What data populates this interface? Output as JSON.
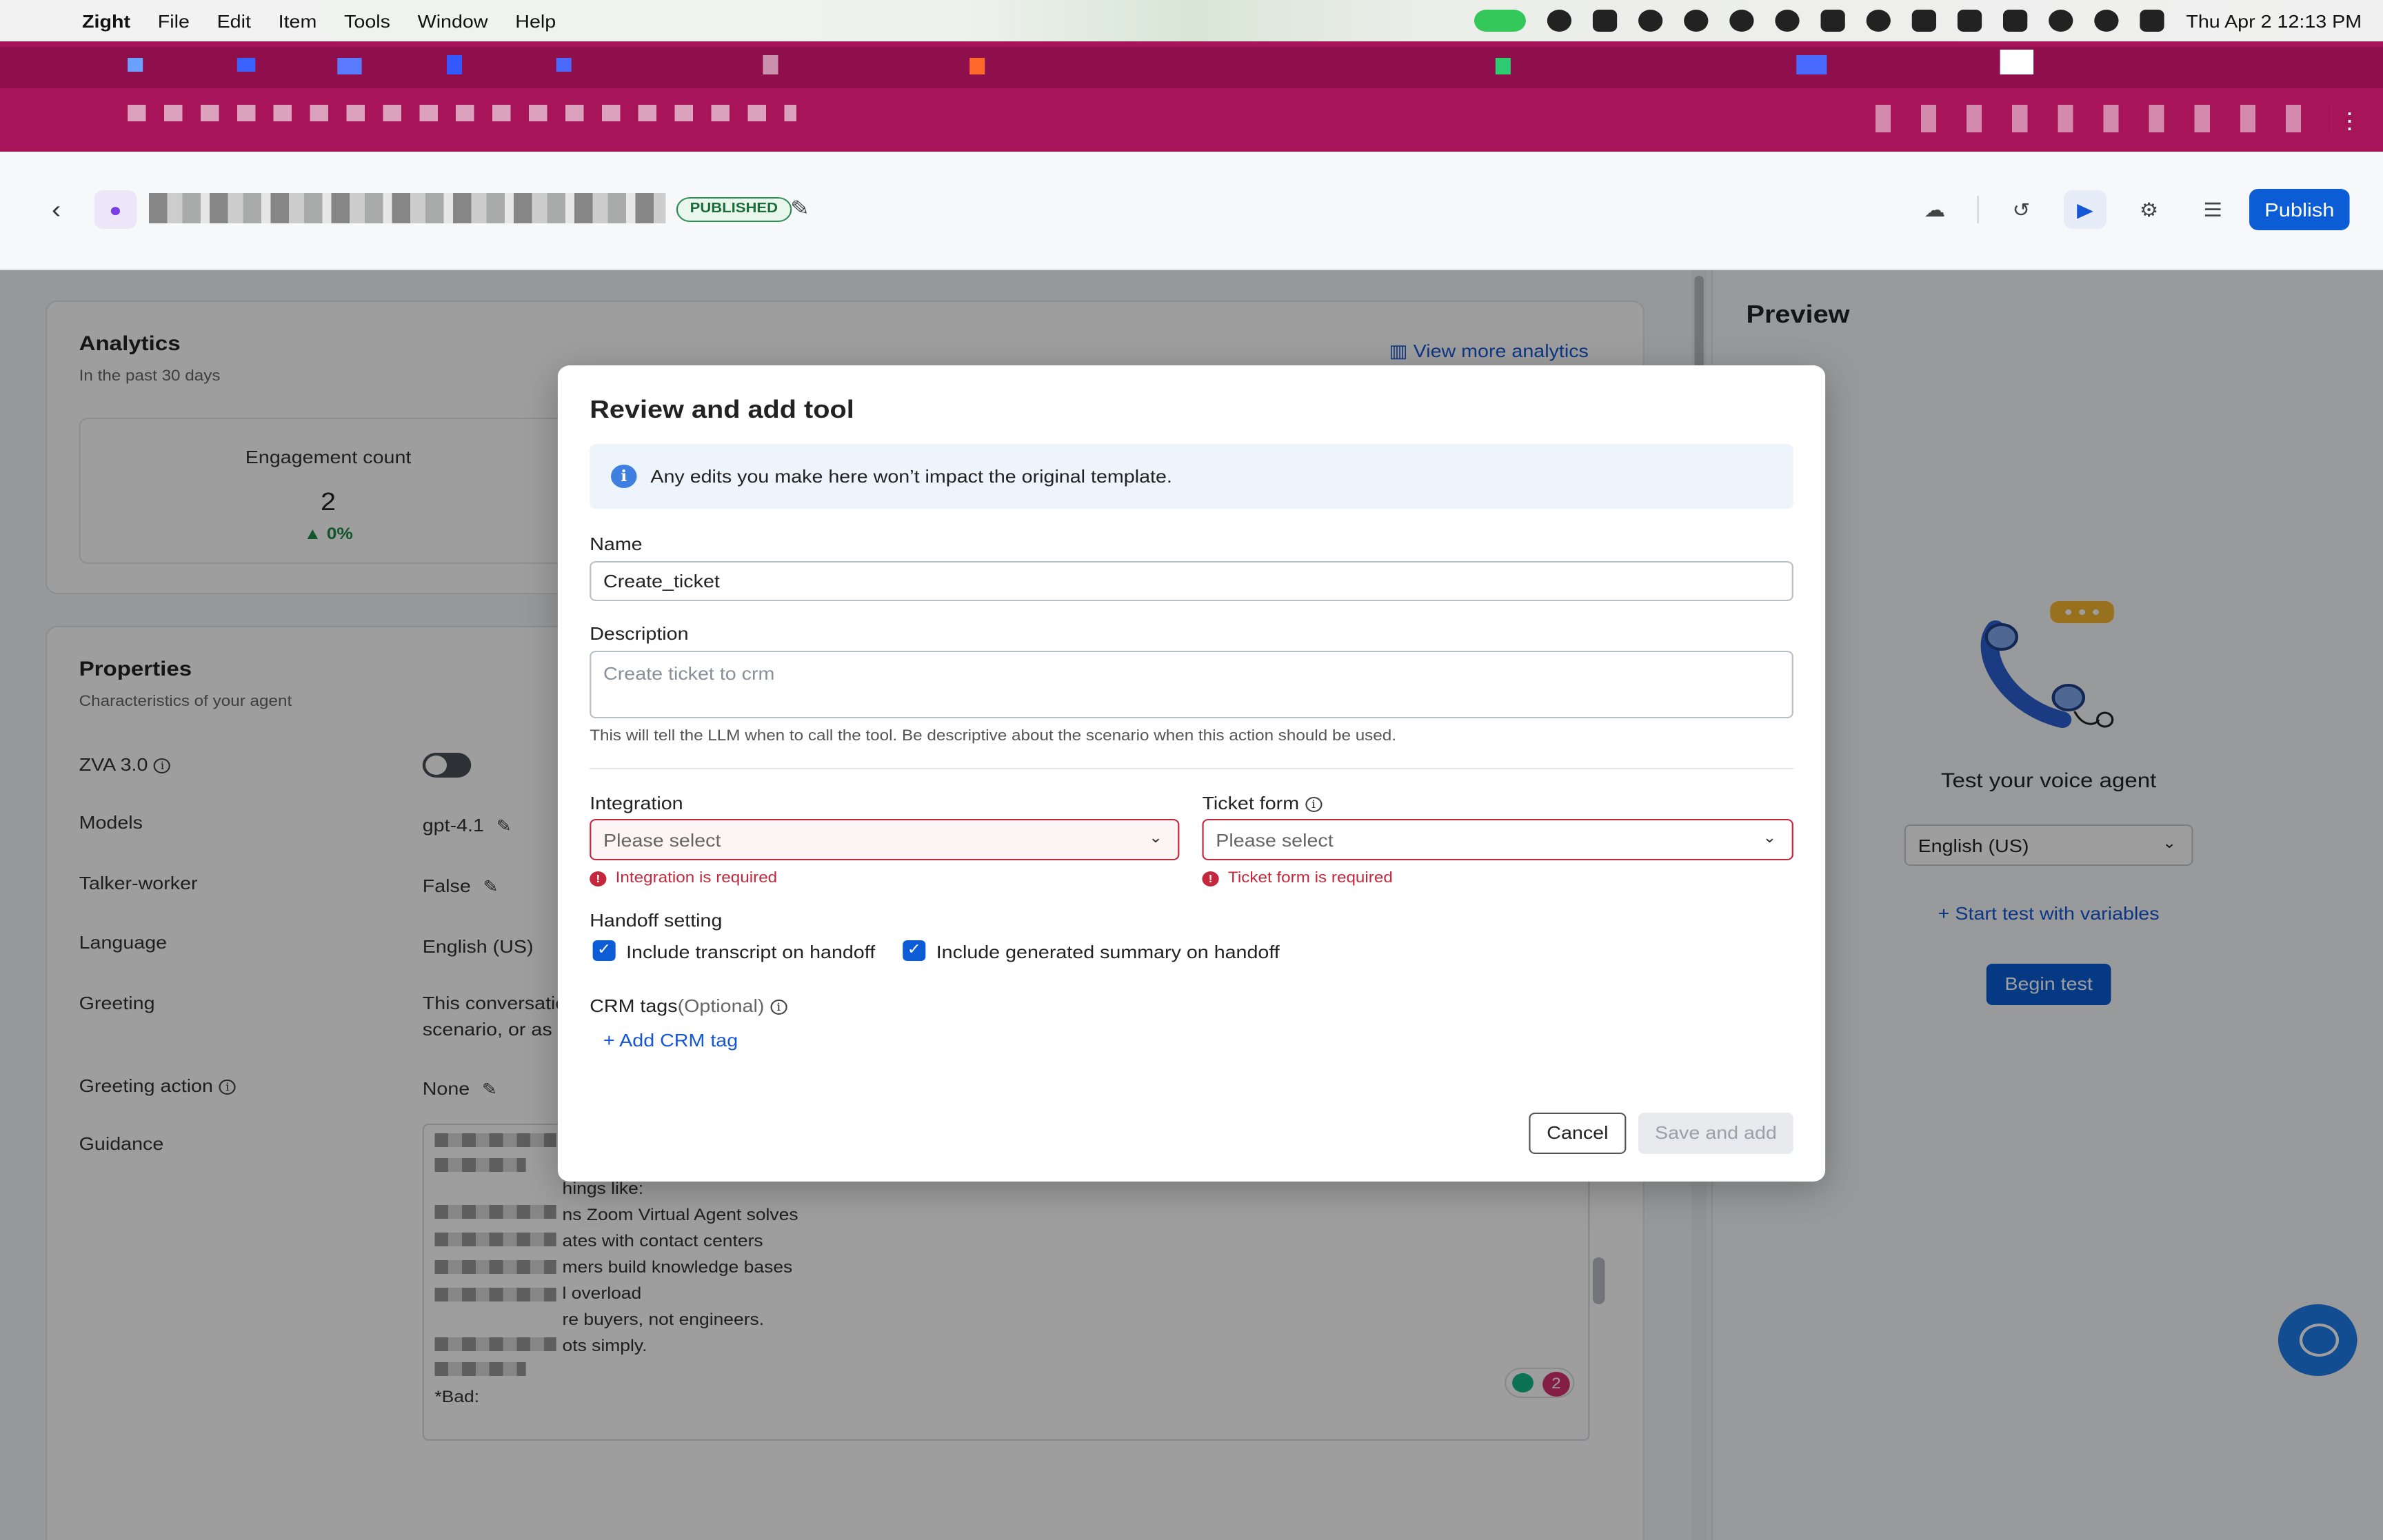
{
  "menubar": {
    "app_name": "Zight",
    "menus": [
      "File",
      "Edit",
      "Item",
      "Tools",
      "Window",
      "Help"
    ],
    "clock": "Thu Apr 2  12:13 PM"
  },
  "header": {
    "status_badge": "PUBLISHED",
    "publish_label": "Publish"
  },
  "analytics": {
    "title": "Analytics",
    "subtitle": "In the past 30 days",
    "view_more": "View more analytics",
    "metric": {
      "label": "Engagement count",
      "value": "2",
      "delta": "▲ 0%"
    }
  },
  "properties": {
    "title": "Properties",
    "subtitle": "Characteristics of your agent",
    "rows": [
      {
        "label": "ZVA 3.0",
        "value": ""
      },
      {
        "label": "Models",
        "value": "gpt-4.1"
      },
      {
        "label": "Talker-worker",
        "value": "False"
      },
      {
        "label": "Language",
        "value": "English (US)"
      },
      {
        "label": "Greeting",
        "value": "This conversatio",
        "value2": "scenario, or as a"
      },
      {
        "label": "Greeting action",
        "value": "None"
      },
      {
        "label": "Guidance",
        "value": ""
      }
    ],
    "guidance_lines": [
      "hings like:",
      "ns Zoom Virtual Agent solves",
      "ates with contact centers",
      "mers build knowledge bases",
      "l overload",
      "re buyers, not engineers.",
      "ots simply.",
      "*Bad:"
    ],
    "grammar_count": "2"
  },
  "preview": {
    "title": "Preview",
    "voice_title": "Test your voice agent",
    "language": "English (US)",
    "start_vars": "Start test with variables",
    "begin_test": "Begin test"
  },
  "modal": {
    "title": "Review and add tool",
    "notice": "Any edits you make here won’t impact the original template.",
    "name_label": "Name",
    "name_value": "Create_ticket",
    "description_label": "Description",
    "description_placeholder": "Create ticket to crm",
    "description_hint": "This will tell the LLM when to call the tool. Be descriptive about the scenario when this action should be used.",
    "integration_label": "Integration",
    "integration_placeholder": "Please select",
    "integration_error": "Integration is required",
    "ticket_form_label": "Ticket form",
    "ticket_form_placeholder": "Please select",
    "ticket_form_error": "Ticket form is required",
    "handoff_label": "Handoff setting",
    "handoff_transcript": "Include transcript on handoff",
    "handoff_summary": "Include generated summary on handoff",
    "crm_tags_label": "CRM tags",
    "crm_tags_optional": "(Optional)",
    "add_crm_tag": "Add CRM tag",
    "cancel": "Cancel",
    "save_and_add": "Save and add"
  }
}
